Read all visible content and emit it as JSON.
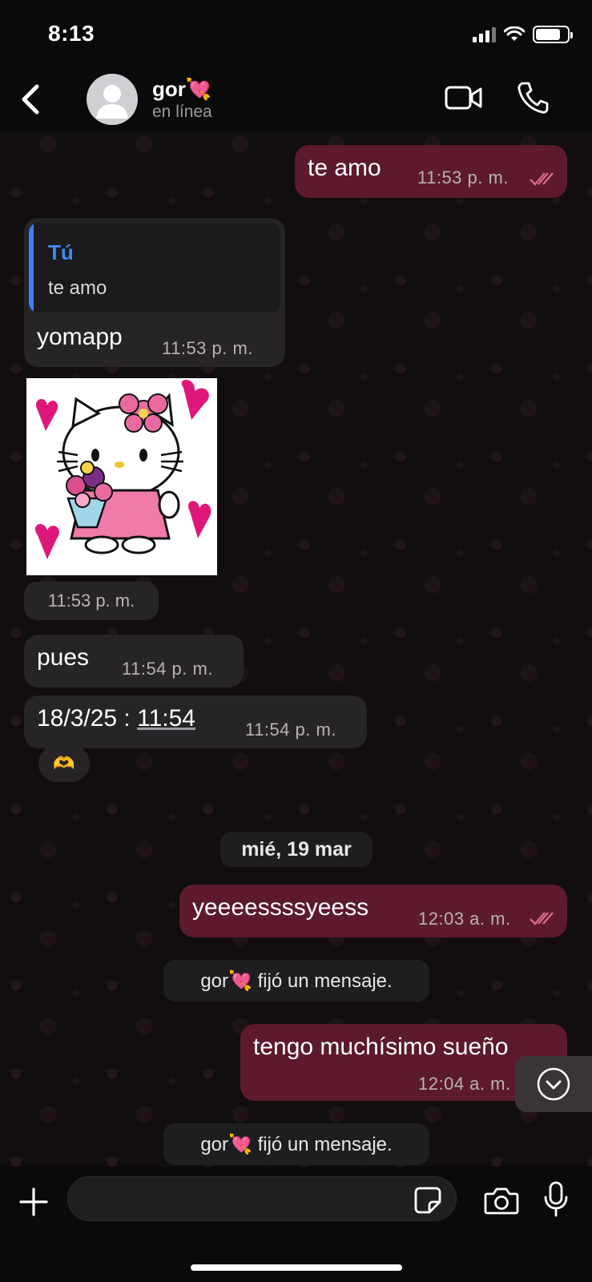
{
  "status_bar": {
    "time": "8:13"
  },
  "header": {
    "contact_name": "gor💘",
    "contact_status": "en línea",
    "back_icon": "chevron-left-icon",
    "video_icon": "video-camera-icon",
    "call_icon": "phone-icon"
  },
  "messages": [
    {
      "id": "m1",
      "direction": "out",
      "text": "te amo",
      "time": "11:53 p. m.",
      "read": true
    },
    {
      "id": "m2",
      "direction": "in",
      "quote_author": "Tú",
      "quote_text": "te amo",
      "text": "yomapp",
      "time": "11:53 p. m."
    },
    {
      "id": "m3",
      "direction": "in",
      "type": "sticker",
      "sticker_desc": "hello-kitty-sticker",
      "time": "11:53 p. m."
    },
    {
      "id": "m4",
      "direction": "in",
      "text": "pues",
      "time": "11:54 p. m."
    },
    {
      "id": "m5",
      "direction": "in",
      "text_prefix": "18/3/25 : ",
      "text_link": "11:54",
      "time": "11:54 p. m.",
      "reaction": "🫶"
    },
    {
      "id": "m6",
      "direction": "out",
      "text": "yeeeessssyeess",
      "time": "12:03 a. m.",
      "read": true
    },
    {
      "id": "m7",
      "direction": "out",
      "text": "tengo muchísimo sueño",
      "time": "12:04 a. m."
    }
  ],
  "date_separator": "mié, 19 mar",
  "system_messages": [
    "gor💘 fijó un mensaje.",
    "gor💘 fijó un mensaje."
  ],
  "composer": {
    "value": "",
    "placeholder": ""
  },
  "colors": {
    "outgoing_bubble": "#5c1a2c",
    "incoming_bubble": "#262427",
    "quote_accent": "#3b82f6",
    "read_ticks": "#d86a86",
    "background": "#120d0f"
  }
}
